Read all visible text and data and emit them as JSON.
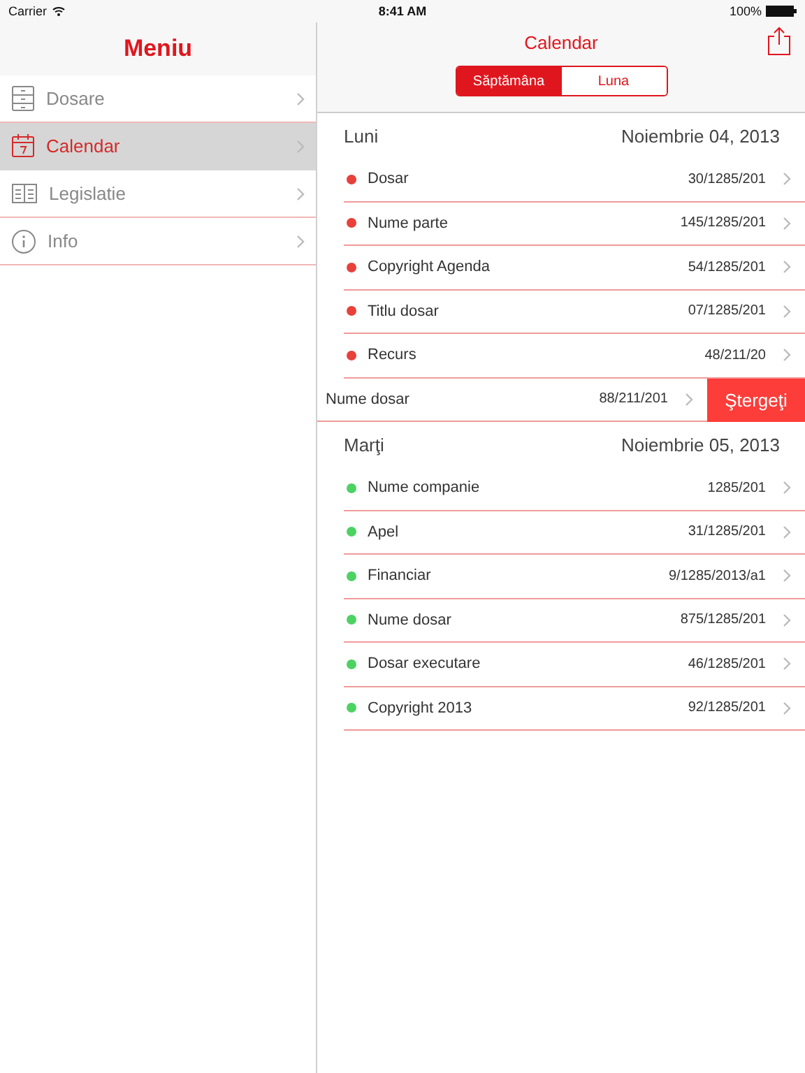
{
  "status_bar": {
    "carrier": "Carrier",
    "time": "8:41 AM",
    "battery": "100%"
  },
  "sidebar": {
    "title": "Meniu",
    "items": [
      {
        "label": "Dosare",
        "kind": "cabinet",
        "selected": false
      },
      {
        "label": "Calendar",
        "kind": "calendar",
        "selected": true
      },
      {
        "label": "Legislatie",
        "kind": "book",
        "selected": false
      },
      {
        "label": "Info",
        "kind": "info",
        "selected": false
      }
    ]
  },
  "header": {
    "title": "Calendar",
    "segments": [
      {
        "label": "Săptămâna",
        "selected": true
      },
      {
        "label": "Luna",
        "selected": false
      }
    ]
  },
  "days": [
    {
      "day": "Luni",
      "date": "Noiembrie 04, 2013",
      "entries": [
        {
          "kind": "normal",
          "name": "Dosar",
          "number": "30/1285/201",
          "color": "#e8413a"
        },
        {
          "kind": "normal",
          "name": "Nume parte",
          "number": "145/1285/201",
          "color": "#e8413a"
        },
        {
          "kind": "normal",
          "name": "Copyright Agenda",
          "number": "54/1285/201",
          "color": "#e8413a"
        },
        {
          "kind": "normal",
          "name": "Titlu dosar",
          "number": "07/1285/201",
          "color": "#e8413a"
        },
        {
          "kind": "normal",
          "name": "Recurs",
          "number": "48/211/20",
          "color": "#e8413a"
        },
        {
          "kind": "swiped",
          "name": "Nume dosar",
          "number": "88/211/201",
          "action": "Ştergeţi"
        }
      ]
    },
    {
      "day": "Marţi",
      "date": "Noiembrie 05, 2013",
      "entries": [
        {
          "kind": "normal",
          "name": "Nume companie",
          "number": "1285/201",
          "color": "#4cd263"
        },
        {
          "kind": "normal",
          "name": "Apel",
          "number": "31/1285/201",
          "color": "#4cd263"
        },
        {
          "kind": "normal",
          "name": "Financiar",
          "number": "9/1285/2013/a1",
          "color": "#4cd263"
        },
        {
          "kind": "normal",
          "name": "Nume dosar",
          "number": "875/1285/201",
          "color": "#4cd263"
        },
        {
          "kind": "normal",
          "name": "Dosar executare",
          "number": "46/1285/201",
          "color": "#4cd263"
        },
        {
          "kind": "normal",
          "name": "Copyright 2013",
          "number": "92/1285/201",
          "color": "#4cd263"
        }
      ]
    }
  ]
}
